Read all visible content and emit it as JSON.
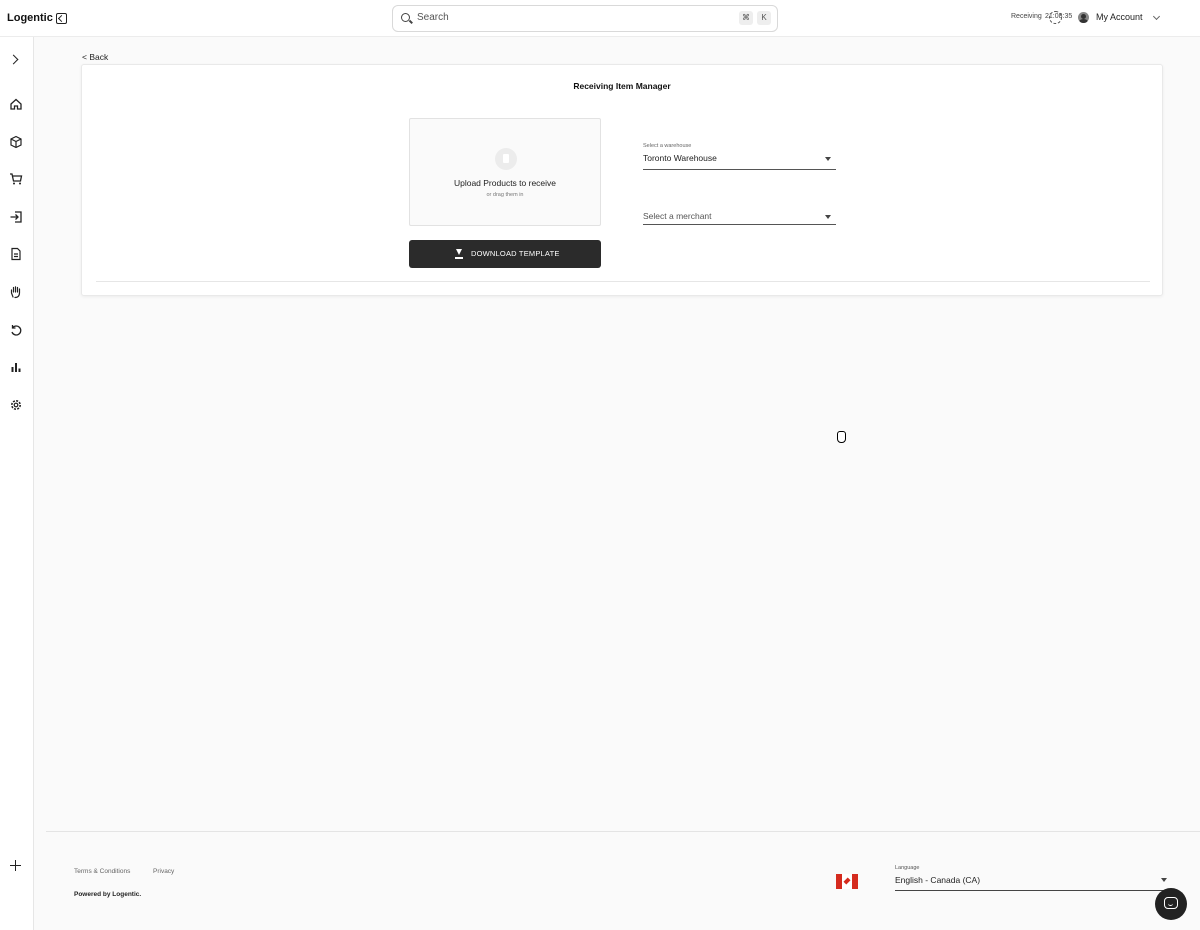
{
  "app": {
    "logo_text": "Logentic"
  },
  "search": {
    "placeholder": "Search",
    "shortcut_cmd": "⌘",
    "shortcut_key": "K"
  },
  "status": {
    "label": "Receiving",
    "time": "21:08:35"
  },
  "account": {
    "label": "My Account"
  },
  "sidebar": {
    "items": [
      {
        "name": "expand",
        "icon": "chevron-right-icon"
      },
      {
        "name": "home",
        "icon": "home-icon"
      },
      {
        "name": "products",
        "icon": "box-icon"
      },
      {
        "name": "orders",
        "icon": "cart-icon"
      },
      {
        "name": "receiving",
        "icon": "inbound-icon"
      },
      {
        "name": "documents",
        "icon": "document-icon"
      },
      {
        "name": "picking",
        "icon": "hand-icon"
      },
      {
        "name": "returns",
        "icon": "undo-icon"
      },
      {
        "name": "reports",
        "icon": "bar-chart-icon"
      },
      {
        "name": "settings",
        "icon": "gear-icon"
      },
      {
        "name": "add",
        "icon": "plus-icon"
      }
    ]
  },
  "nav": {
    "back_label": "< Back"
  },
  "card": {
    "title": "Receiving Item Manager",
    "upload_title": "Upload Products to receive",
    "upload_subtitle": "or drag them in",
    "download_label": "DOWNLOAD TEMPLATE",
    "warehouse_label": "Select a warehouse",
    "warehouse_value": "Toronto Warehouse",
    "merchant_placeholder": "Select a merchant"
  },
  "footer": {
    "terms": "Terms & Conditions",
    "privacy": "Privacy",
    "powered": "Powered by Logentic.",
    "language_label": "Language",
    "language_value": "English - Canada (CA)"
  },
  "colors": {
    "button_bg": "#2b2b2b",
    "flag_red": "#d52b1e",
    "page_bg": "#fafafa"
  }
}
